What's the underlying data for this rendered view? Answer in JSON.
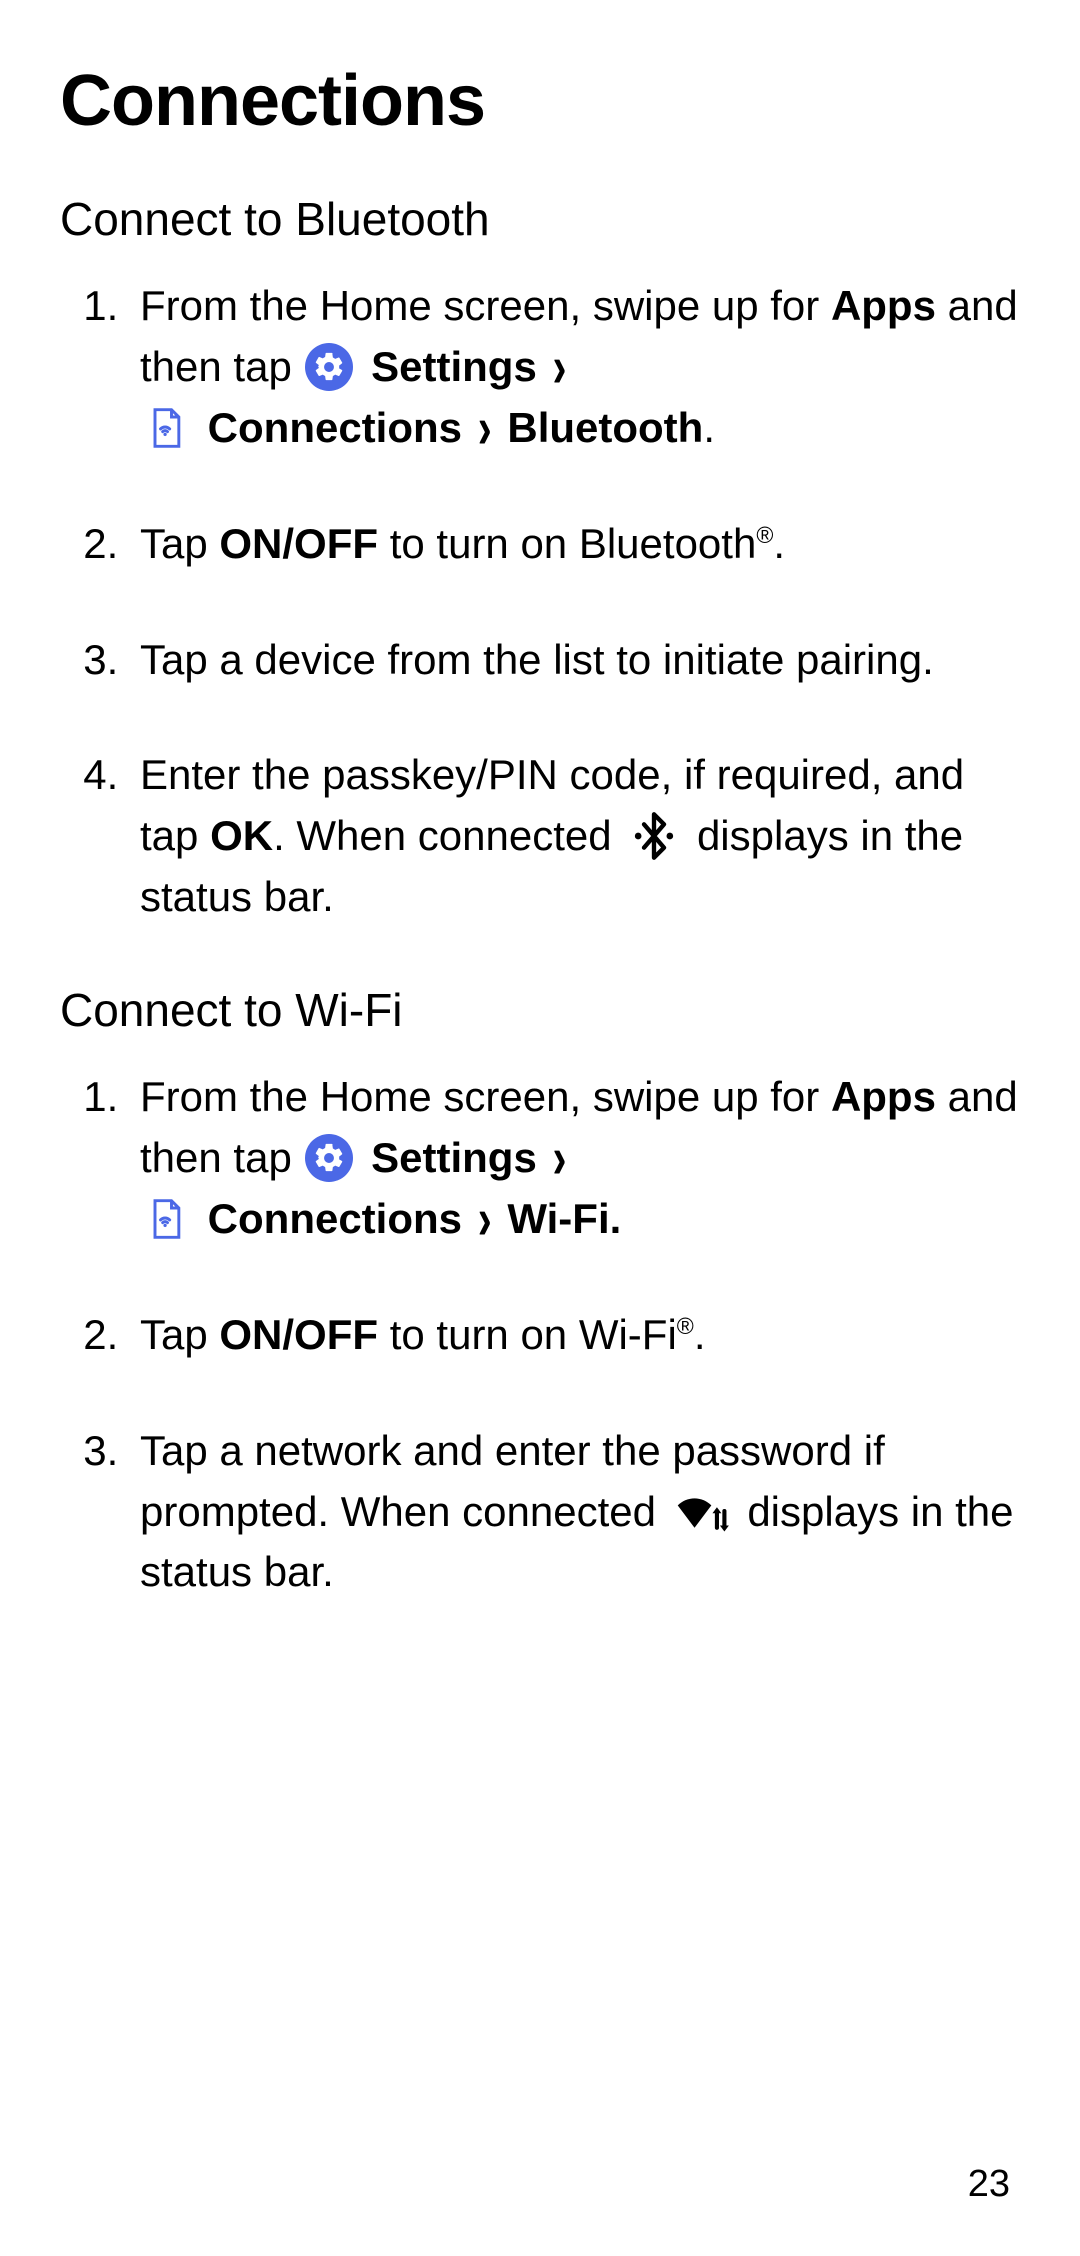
{
  "title": "Connections",
  "page_number": "23",
  "sections": {
    "bluetooth": {
      "heading": "Connect to Bluetooth",
      "step1": {
        "pre": "From the Home screen, swipe up for ",
        "apps": "Apps",
        "mid1": " and then tap ",
        "settings": "Settings",
        "chev": "›",
        "connections": "Connections",
        "bluetooth": "Bluetooth",
        "end": "."
      },
      "step2": {
        "pre": "Tap ",
        "onoff": "ON/OFF",
        "mid": " to turn on Bluetooth",
        "reg": "®",
        "end": "."
      },
      "step3": "Tap a device from the list to initiate pairing.",
      "step4": {
        "pre": "Enter the passkey/PIN code, if required, and tap ",
        "ok": "OK",
        "mid": ". When connected ",
        "end": " displays in the status bar."
      }
    },
    "wifi": {
      "heading": "Connect to Wi-Fi",
      "step1": {
        "pre": "From the Home screen, swipe up for ",
        "apps": "Apps",
        "mid1": " and then tap ",
        "settings": "Settings",
        "chev": "›",
        "connections": "Connections",
        "wifi": "Wi-Fi.",
        "end": ""
      },
      "step2": {
        "pre": "Tap ",
        "onoff": "ON/OFF",
        "mid": " to turn on Wi-Fi",
        "reg": "®",
        "end": "."
      },
      "step3": {
        "pre": "Tap a network and enter the password if prompted. When connected ",
        "end": " displays in the status bar."
      }
    }
  }
}
